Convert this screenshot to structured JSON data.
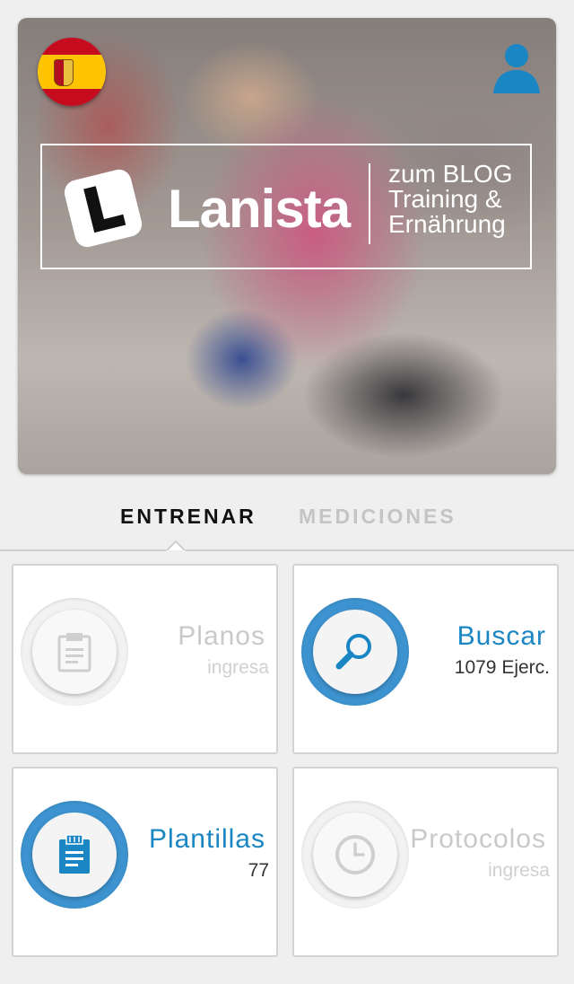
{
  "hero": {
    "logo_word": "Lanista",
    "blog_line1": "zum BLOG",
    "blog_line2": "Training &",
    "blog_line3": "Ernährung"
  },
  "icons": {
    "language_flag": "spain-flag-icon",
    "profile": "user-icon"
  },
  "tabs": [
    {
      "label": "ENTRENAR",
      "active": true
    },
    {
      "label": "MEDICIONES",
      "active": false
    }
  ],
  "cards": [
    {
      "title": "Planos",
      "subtitle": "ingresa",
      "icon": "document-icon",
      "enabled": false
    },
    {
      "title": "Buscar",
      "subtitle": "1079 Ejerc.",
      "icon": "search-icon",
      "enabled": true
    },
    {
      "title": "Plantillas",
      "subtitle": "77",
      "icon": "document-icon",
      "enabled": true
    },
    {
      "title": "Protocolos",
      "subtitle": "ingresa",
      "icon": "clock-icon",
      "enabled": false
    }
  ],
  "colors": {
    "accent": "#1a86c3",
    "ring": "#3d93cf",
    "disabled_text": "#c9c9c9"
  }
}
